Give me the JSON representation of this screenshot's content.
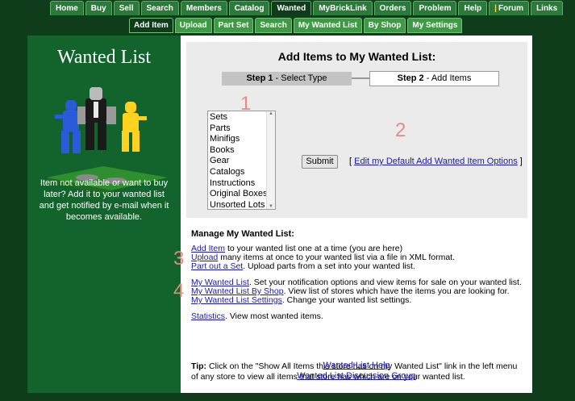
{
  "top_nav": [
    "Home",
    "Buy",
    "Sell",
    "Search",
    "Members",
    "Catalog",
    "Wanted",
    "MyBrickLink",
    "Orders",
    "Problem",
    "Help",
    "Forum",
    "Links"
  ],
  "top_nav_active": "Wanted",
  "sub_nav": [
    "Add Item",
    "Upload",
    "Part Set",
    "Search",
    "My Wanted List",
    "By Shop",
    "My Settings"
  ],
  "sub_nav_active": "Add Item",
  "left": {
    "title": "Wanted List",
    "blurb": "Item not available or want to buy later? Add it to your wanted list and get notified by e-mail when it becomes available."
  },
  "panel": {
    "title": "Add Items to My Wanted List:",
    "step1_label": "Step 1",
    "step1_text": " - Select Type",
    "step2_label": "Step 2",
    "step2_text": " - Add Items",
    "type_options": [
      "Sets",
      "Parts",
      "Minifigs",
      "Books",
      "Gear",
      "Catalogs",
      "Instructions",
      "Original Boxes",
      "Unsorted Lots"
    ],
    "submit_label": "Submit",
    "edit_prefix": "[ ",
    "edit_link": "Edit my Default Add Wanted Item Options",
    "edit_suffix": " ]"
  },
  "annotations": [
    "1",
    "2",
    "3",
    "4"
  ],
  "manage": {
    "heading": "Manage My Wanted List:",
    "items": [
      {
        "link": "Add Item",
        "text": " to your wanted list one at a time (you are here)"
      },
      {
        "link": "Upload",
        "text": " many items at once to your wanted list via a file in XML format."
      },
      {
        "link": "Part out a Set",
        "text": ". Upload parts from a set into your wanted list."
      },
      {
        "link": "My Wanted List",
        "text": ". Set your notification options and view items for sale on your wanted list."
      },
      {
        "link": "My Wanted List By Shop",
        "text": ". View list of stores which have the items you are looking for."
      },
      {
        "link": "My Wanted List Settings",
        "text": ". Change your wanted list settings."
      },
      {
        "link": "Statistics",
        "text": ". View most wanted items."
      }
    ],
    "tip_label": "Tip:",
    "tip_text": " Click on the \"Show All Items this store has on my Wanted List\" link in the left menu of any store to view all items that store has which are on your wanted list."
  },
  "footer_links": [
    "Wanted List Help",
    "Wanted List Discussion Group"
  ],
  "colors": {
    "page_bg": "#0f3d1c",
    "left_panel": "#12632c",
    "tab": "#2a7a3a",
    "annotation": "#e88a82",
    "link": "#1a1aa6"
  }
}
